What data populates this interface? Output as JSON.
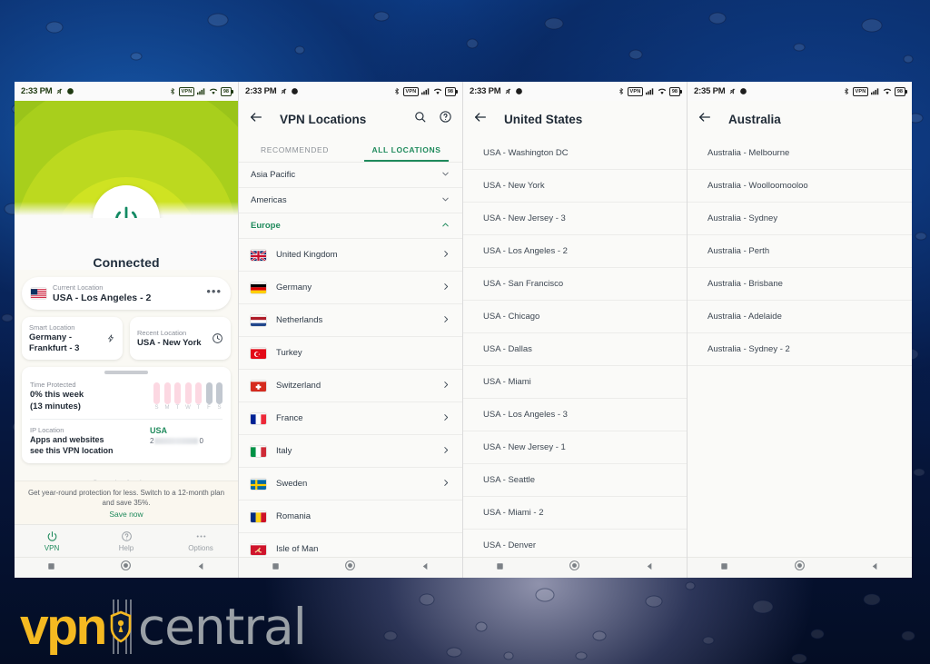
{
  "watermark": {
    "brand_primary": "vpn",
    "brand_secondary": "central",
    "color_primary": "#f5b921",
    "color_secondary": "#9aa0a6"
  },
  "theme": {
    "accent_green": "#1f8a5c",
    "hero_green": "#9ac41a",
    "hero_lime": "#cfe322",
    "muted": "#8a8f99"
  },
  "panel1": {
    "status": {
      "time": "2:33 PM",
      "icons": [
        "mute-icon",
        "data-saver-icon",
        "bluetooth-icon",
        "vpn-icon",
        "signal-icon",
        "wifi-icon",
        "battery-icon"
      ],
      "vpn_chip": "VPN",
      "battery": "98"
    },
    "connection_state": "Connected",
    "power_icon": "power-icon",
    "current_location": {
      "label": "Current Location",
      "value": "USA - Los Angeles - 2",
      "flag": "us-flag",
      "menu": "•••"
    },
    "smart_location": {
      "label": "Smart Location",
      "value": "Germany - Frankfurt - 3",
      "icon": "lightning-icon"
    },
    "recent_location": {
      "label": "Recent Location",
      "value": "USA - New York",
      "icon": "clock-icon"
    },
    "time_protected": {
      "label": "Time Protected",
      "value_line1": "0% this week",
      "value_line2": "(13 minutes)",
      "days": [
        "S",
        "M",
        "T",
        "W",
        "T",
        "F",
        "S"
      ],
      "bar_states": [
        "pink",
        "pink",
        "pink",
        "pink",
        "pink",
        "gray",
        "gray"
      ]
    },
    "ip_location": {
      "label": "IP Location",
      "description_line1": "Apps and websites",
      "description_line2": "see this VPN location",
      "country": "USA",
      "ip_prefix": "2",
      "ip_suffix": "0"
    },
    "security_assistant": "Security Assistant",
    "promo": {
      "line1": "Get year-round protection for less. Switch to a 12-month plan",
      "line2": "and save 35%.",
      "cta": "Save now"
    },
    "tabbar": [
      {
        "label": "VPN",
        "icon": "power-icon",
        "active": true
      },
      {
        "label": "Help",
        "icon": "question-circle-icon",
        "active": false
      },
      {
        "label": "Options",
        "icon": "ellipsis-icon",
        "active": false
      }
    ]
  },
  "panel2": {
    "status": {
      "time": "2:33 PM",
      "vpn_chip": "VPN",
      "battery": "98"
    },
    "title": "VPN Locations",
    "back_icon": "arrow-left-icon",
    "actions": [
      "search-icon",
      "help-circle-icon"
    ],
    "tabs": [
      {
        "label": "RECOMMENDED",
        "active": false
      },
      {
        "label": "ALL LOCATIONS",
        "active": true
      }
    ],
    "groups": [
      {
        "label": "Asia Pacific",
        "expanded": false
      },
      {
        "label": "Americas",
        "expanded": false
      },
      {
        "label": "Europe",
        "expanded": true
      }
    ],
    "countries": [
      {
        "name": "United Kingdom",
        "flag": "gb-flag",
        "chevron": true
      },
      {
        "name": "Germany",
        "flag": "de-flag",
        "chevron": true
      },
      {
        "name": "Netherlands",
        "flag": "nl-flag",
        "chevron": true
      },
      {
        "name": "Turkey",
        "flag": "tr-flag",
        "chevron": false
      },
      {
        "name": "Switzerland",
        "flag": "ch-flag",
        "chevron": true
      },
      {
        "name": "France",
        "flag": "fr-flag",
        "chevron": true
      },
      {
        "name": "Italy",
        "flag": "it-flag",
        "chevron": true
      },
      {
        "name": "Sweden",
        "flag": "se-flag",
        "chevron": true
      },
      {
        "name": "Romania",
        "flag": "ro-flag",
        "chevron": false
      },
      {
        "name": "Isle of Man",
        "flag": "im-flag",
        "chevron": false
      }
    ]
  },
  "panel3": {
    "status": {
      "time": "2:33 PM",
      "vpn_chip": "VPN",
      "battery": "98"
    },
    "title": "United States",
    "back_icon": "arrow-left-icon",
    "cities": [
      "USA - Washington DC",
      "USA - New York",
      "USA - New Jersey - 3",
      "USA - Los Angeles - 2",
      "USA - San Francisco",
      "USA - Chicago",
      "USA - Dallas",
      "USA - Miami",
      "USA - Los Angeles - 3",
      "USA - New Jersey - 1",
      "USA - Seattle",
      "USA - Miami - 2",
      "USA - Denver"
    ]
  },
  "panel4": {
    "status": {
      "time": "2:35 PM",
      "vpn_chip": "VPN",
      "battery": "98"
    },
    "title": "Australia",
    "back_icon": "arrow-left-icon",
    "cities": [
      "Australia - Melbourne",
      "Australia - Woolloomooloo",
      "Australia - Sydney",
      "Australia - Perth",
      "Australia - Brisbane",
      "Australia - Adelaide",
      "Australia - Sydney - 2"
    ]
  },
  "navbar": {
    "recent": "square-icon",
    "home": "circle-icon",
    "back": "triangle-back-icon"
  }
}
